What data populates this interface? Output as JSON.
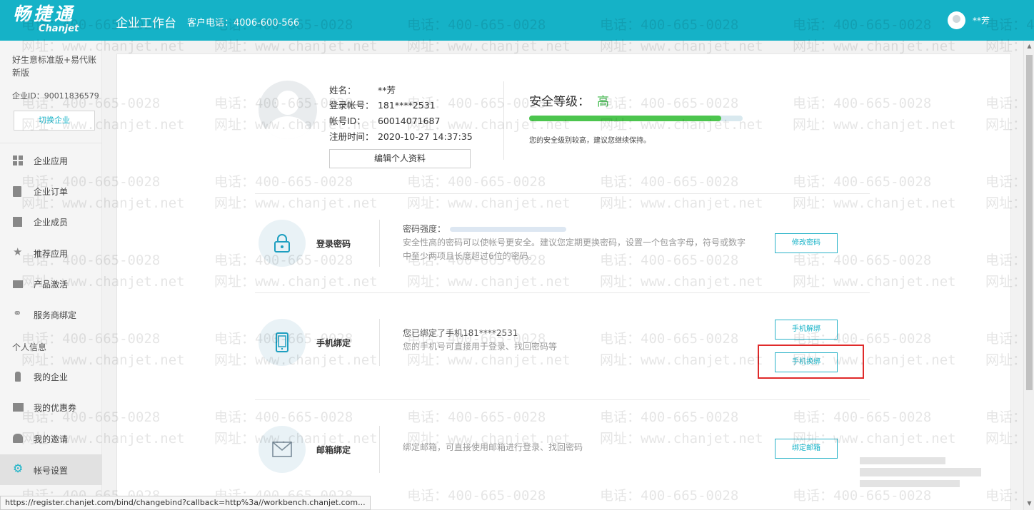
{
  "header": {
    "logo_cn": "畅捷通",
    "logo_en": "Chanjet",
    "title": "企业工作台",
    "phone": "客户电话：4006-600-566",
    "user": "**芳"
  },
  "sidebar": {
    "company_name": "好生意标准版+易代账新版",
    "company_id": "企业ID：90011836579",
    "switch_label": "切换企业",
    "items": [
      {
        "label": "企业应用",
        "icon": "grid-icon"
      },
      {
        "label": "企业订单",
        "icon": "order-icon"
      },
      {
        "label": "企业成员",
        "icon": "building-icon"
      },
      {
        "label": "推荐应用",
        "icon": "star-icon"
      },
      {
        "label": "产品激活",
        "icon": "activate-icon"
      },
      {
        "label": "服务商绑定",
        "icon": "link-icon"
      }
    ],
    "section_personal": "个人信息",
    "personal_items": [
      {
        "label": "我的企业",
        "icon": "person-icon"
      },
      {
        "label": "我的优惠券",
        "icon": "coupon-icon"
      },
      {
        "label": "我的邀请",
        "icon": "invite-icon"
      },
      {
        "label": "帐号设置",
        "icon": "gear-icon",
        "active": true
      }
    ]
  },
  "profile": {
    "name_label": "姓名：",
    "name_value": "**芳",
    "login_label": "登录帐号：",
    "login_value": "181****2531",
    "id_label": "帐号ID：",
    "id_value": "60014071687",
    "reg_label": "注册时间：",
    "reg_value": "2020-10-27 14:37:35",
    "edit_label": "编辑个人资料"
  },
  "security": {
    "title": "安全等级：",
    "level": "高",
    "level_fraction": 0.9,
    "tip": "您的安全级别较高，建议您继续保持。",
    "level_color": "#3db84a"
  },
  "rows": {
    "password": {
      "title": "登录密码",
      "strength_label": "密码强度：",
      "desc": "安全性高的密码可以使帐号更安全。建议您定期更换密码，设置一个包含字母，符号或数字中至少两项且长度超过6位的密码。",
      "button": "修改密码"
    },
    "phone": {
      "title": "手机绑定",
      "bound": "您已绑定了手机181****2531",
      "desc": "您的手机号可直接用于登录、找回密码等",
      "button_unbind": "手机解绑",
      "button_change": "手机换绑"
    },
    "email": {
      "title": "邮箱绑定",
      "desc": "绑定邮箱，可直接使用邮箱进行登录、找回密码",
      "button": "绑定邮箱"
    }
  },
  "watermark": {
    "phone": "电话：400-665-0028",
    "site": "网址：www.chanjet.net"
  },
  "status_bar": {
    "url": "https://register.chanjet.com/bind/changebind?callback=http%3a//workbench.chanjet.com..."
  },
  "colors": {
    "brand": "#15b2c7",
    "highlight": "#e02a2a",
    "success": "#4cc54e"
  }
}
